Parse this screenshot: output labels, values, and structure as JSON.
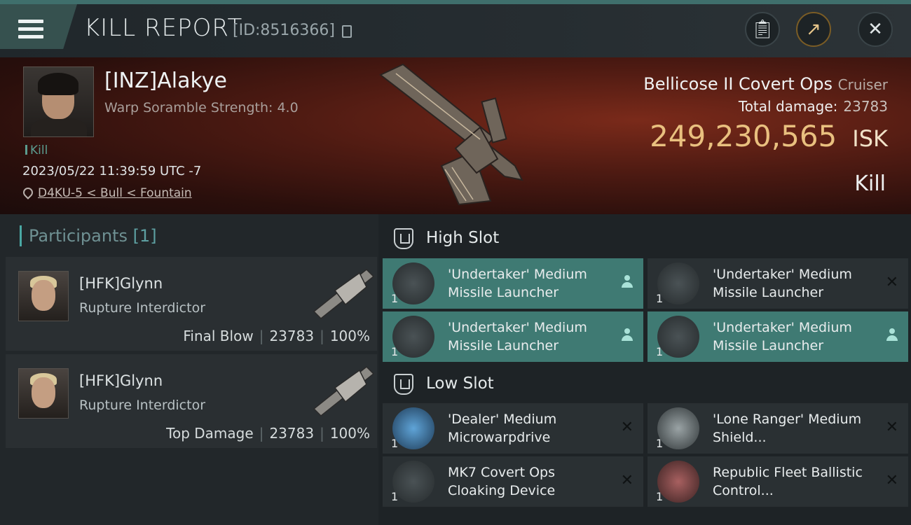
{
  "header": {
    "title": "KILL REPORT",
    "report_id": "[ID:8516366]"
  },
  "victim": {
    "name": "[INZ]Alakye",
    "scramble": "Warp Soramble Strength: 4.0",
    "tag": "Kill",
    "datetime": "2023/05/22 11:39:59 UTC -7",
    "location": "D4KU-5 < Bull < Fountain",
    "ship_name": "Bellicose II Covert Ops",
    "ship_class": "Cruiser",
    "total_damage_label": "Total damage:",
    "total_damage": "23783",
    "isk_value": "249,230,565",
    "isk_unit": "ISK",
    "result": "Kill"
  },
  "participants": {
    "label": "Participants",
    "count": "[1]",
    "cards": [
      {
        "name": "[HFK]Glynn",
        "ship": "Rupture Interdictor",
        "role": "Final Blow",
        "damage": "23783",
        "percent": "100%"
      },
      {
        "name": "[HFK]Glynn",
        "ship": "Rupture Interdictor",
        "role": "Top Damage",
        "damage": "23783",
        "percent": "100%"
      }
    ]
  },
  "slots": {
    "high": {
      "label": "High Slot",
      "items": [
        {
          "name": "'Undertaker' Medium Missile Launcher",
          "qty": "1",
          "icon": "missile-launcher-icon"
        },
        {
          "name": "'Undertaker' Medium Missile Launcher",
          "qty": "1",
          "icon": "missile-launcher-icon"
        },
        {
          "name": "'Undertaker' Medium Missile Launcher",
          "qty": "1",
          "icon": "missile-launcher-icon"
        },
        {
          "name": "'Undertaker' Medium Missile Launcher",
          "qty": "1",
          "icon": "missile-launcher-icon"
        }
      ]
    },
    "low": {
      "label": "Low Slot",
      "items": [
        {
          "name": "'Dealer' Medium Microwarpdrive",
          "qty": "1",
          "icon": "microwarpdrive-icon"
        },
        {
          "name": "'Lone Ranger' Medium Shield...",
          "qty": "1",
          "icon": "shield-icon"
        },
        {
          "name": "MK7 Covert Ops Cloaking Device",
          "qty": "1",
          "icon": "cloaking-device-icon"
        },
        {
          "name": "Republic Fleet Ballistic Control...",
          "qty": "1",
          "icon": "ballistic-control-icon"
        }
      ]
    }
  },
  "colors": {
    "accent": "#3f7a73",
    "isk": "#e9c07f"
  }
}
